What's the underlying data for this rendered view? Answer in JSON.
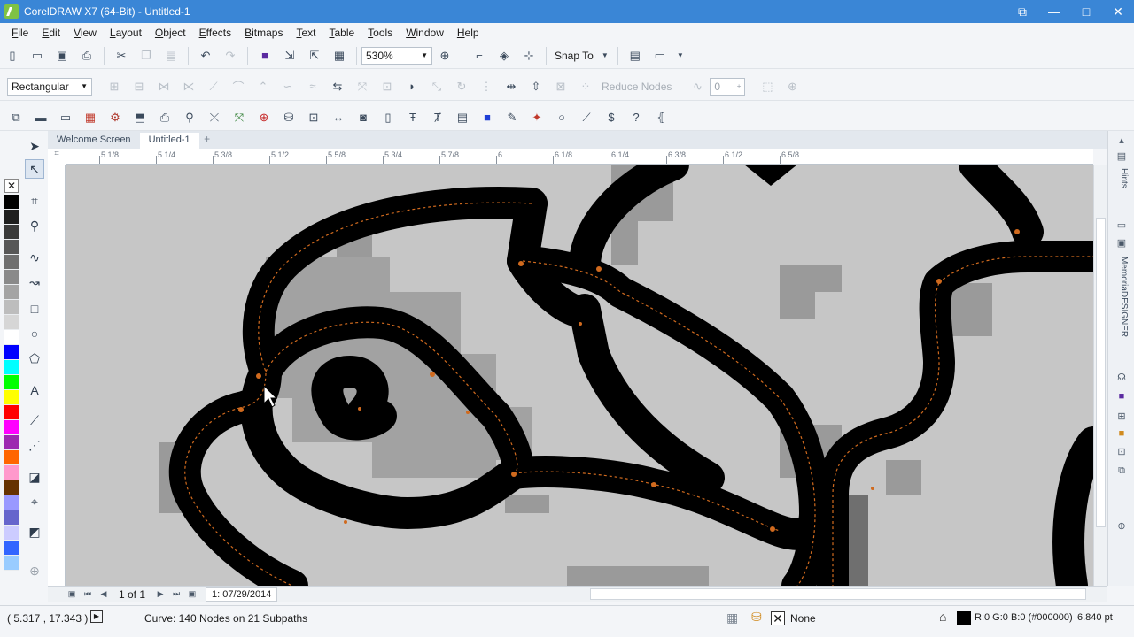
{
  "window": {
    "title": "CorelDRAW X7 (64-Bit) - Untitled-1",
    "controls": [
      "restore-down",
      "minimize",
      "maximize",
      "close"
    ]
  },
  "menu": [
    "File",
    "Edit",
    "View",
    "Layout",
    "Object",
    "Effects",
    "Bitmaps",
    "Text",
    "Table",
    "Tools",
    "Window",
    "Help"
  ],
  "toolbar_standard": {
    "zoom_value": "530%",
    "snap_label": "Snap To"
  },
  "property_bar": {
    "selection_mode": "Rectangular",
    "reduce_nodes_label": "Reduce Nodes",
    "curve_smoothness_value": "0"
  },
  "document_tabs": [
    {
      "label": "Welcome Screen",
      "active": false
    },
    {
      "label": "Untitled-1",
      "active": true
    }
  ],
  "ruler": {
    "units": "inches",
    "top_labels": [
      "5 1/8",
      "5 1/4",
      "5 3/8",
      "5 1/2",
      "5 5/8",
      "5 3/4",
      "5 7/8",
      "6",
      "6 1/8",
      "6 1/4",
      "6 3/8",
      "6 1/2",
      "6 5/8"
    ]
  },
  "page_nav": {
    "page_count": "1 of 1",
    "page_tab": "1: 07/29/2014"
  },
  "docker_tabs": [
    "Hints",
    "MemoriaDESIGNER"
  ],
  "status": {
    "cursor_position": "( 5.317 , 17.343 )",
    "selection_info": "Curve: 140 Nodes on 21 Subpaths",
    "fill_label": "None",
    "outline_color": "R:0 G:0 B:0 (#000000)",
    "outline_width": "6.840 pt"
  },
  "colors": {
    "titlebar": "#3a86d6",
    "outline": "#000000",
    "node": "#d06a1e",
    "canvas": "#c6c6c6"
  },
  "palette": [
    "#000000",
    "#1f1f1f",
    "#3a3a3a",
    "#575757",
    "#6f6f6f",
    "#8a8a8a",
    "#a4a4a4",
    "#bdbdbd",
    "#d6d6d6",
    "#ffffff",
    "#0000ff",
    "#00ffff",
    "#00ff00",
    "#ffff00",
    "#ff0000",
    "#ff00ff",
    "#9c27b0",
    "#ff6600",
    "#ff99cc",
    "#663300",
    "#9999ff",
    "#6666cc",
    "#ccccff",
    "#3366ff",
    "#99ccff"
  ]
}
